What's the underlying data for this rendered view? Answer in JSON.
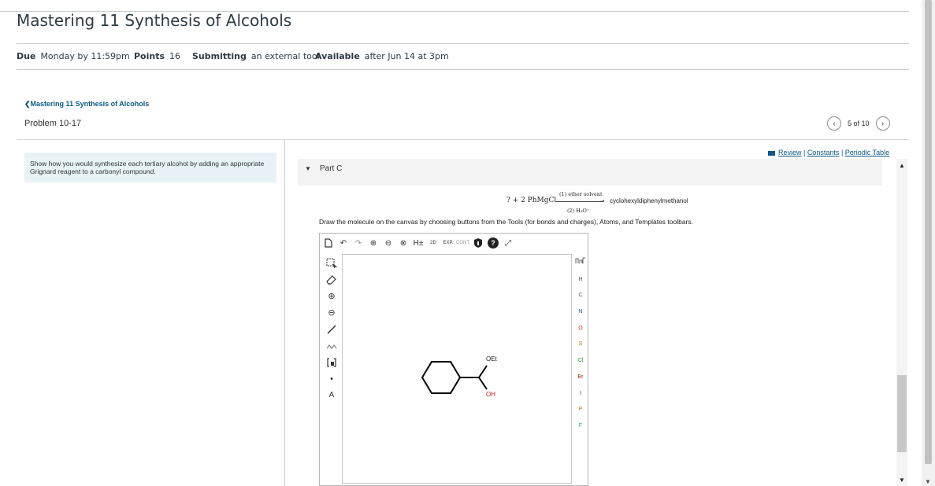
{
  "page": {
    "title": "Mastering 11 Synthesis of Alcohols"
  },
  "meta": {
    "due_label": "Due",
    "due_value": "Monday by 11:59pm",
    "points_label": "Points",
    "points_value": "16",
    "submitting_label": "Submitting",
    "submitting_value": "an external tool",
    "available_label": "Available",
    "available_value": "after Jun 14 at 3pm"
  },
  "frame": {
    "back_link": "Mastering 11 Synthesis of Alcohols",
    "problem_label": "Problem 10-17",
    "pager_text": "5 of 10",
    "instructions": "Show how you would synthesize each tertiary alcohol by adding an appropriate Grignard reagent to a carbonyl compound.",
    "links": {
      "review": "Review",
      "constants": "Constants",
      "periodic_table": "Periodic Table",
      "sep": "|"
    },
    "part_label": "Part C"
  },
  "reaction": {
    "lhs": "? + 2 PhMgCl",
    "condition1": "(1) ether solvent",
    "condition2": "(2) H₃O⁺",
    "product": "cyclohexyldiphenylmethanol"
  },
  "draw_instructions": "Draw the molecule on the canvas by choosing buttons from the Tools (for bonds and charges), Atoms, and Templates toolbars.",
  "toolbar": {
    "h_label": "H±",
    "label_2d": "2D",
    "exp_label": "EXP.",
    "cont_label": "CONT.",
    "help_label": "?"
  },
  "atoms": [
    "H",
    "C",
    "N",
    "O",
    "S",
    "Cl",
    "Br",
    "I",
    "P",
    "F"
  ],
  "atom_colors": {
    "H": "#555555",
    "C": "#555555",
    "N": "#3050c0",
    "O": "#d02020",
    "S": "#a08000",
    "Cl": "#20a020",
    "Br": "#a03020",
    "I": "#800080",
    "P": "#d07000",
    "F": "#20a0a0"
  },
  "molecule": {
    "label_oet": "OEt",
    "label_oh": "OH"
  }
}
